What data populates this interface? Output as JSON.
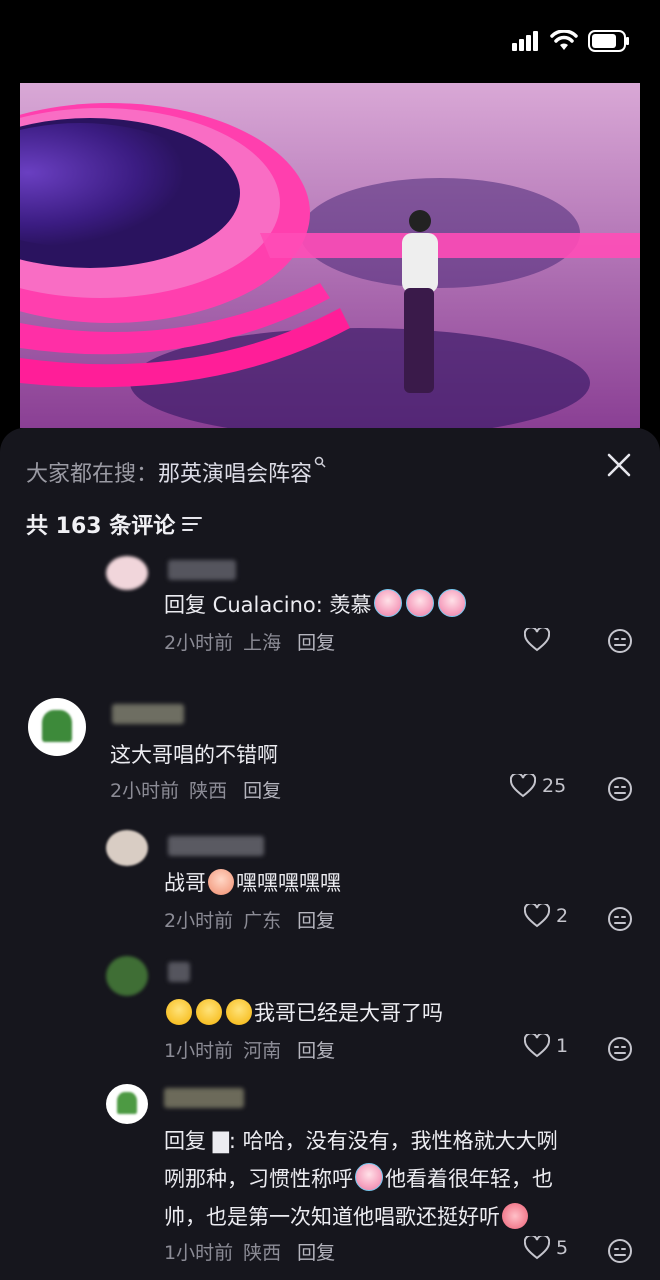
{
  "search": {
    "prefix": "大家都在搜：",
    "keyword": "那英演唱会阵容"
  },
  "comments_header": {
    "count_label": "共 163 条评论"
  },
  "comments": [
    {
      "text": "回复 Cualacino: 羡慕",
      "time": "2小时前",
      "location": "上海",
      "reply_label": "回复",
      "likes": ""
    },
    {
      "text": "这大哥唱的不错啊",
      "time": "2小时前",
      "location": "陕西",
      "reply_label": "回复",
      "likes": "25"
    },
    {
      "text_a": "战哥",
      "text_b": "嘿嘿嘿嘿嘿",
      "time": "2小时前",
      "location": "广东",
      "reply_label": "回复",
      "likes": "2"
    },
    {
      "text": "我哥已经是大哥了吗",
      "time": "1小时前",
      "location": "河南",
      "reply_label": "回复",
      "likes": "1"
    },
    {
      "line1": "回复 ▇: 哈哈，没有没有，我性格就大大咧",
      "line2a": "咧那种，习惯性称呼",
      "line2b": "他看着很年轻，也",
      "line3": "帅，也是第一次知道他唱歌还挺好听",
      "time": "1小时前",
      "location": "陕西",
      "reply_label": "回复",
      "likes": "5"
    }
  ],
  "icons": {
    "signal": "signal-icon",
    "wifi": "wifi-icon",
    "battery": "battery-icon",
    "close": "close-icon",
    "sort": "sort-icon",
    "like": "heart-icon",
    "emoji_react": "emoji-face-icon"
  },
  "colors": {
    "panel_bg": "#16161d",
    "page_bg": "#000000",
    "meta_text": "#8c8c96"
  }
}
